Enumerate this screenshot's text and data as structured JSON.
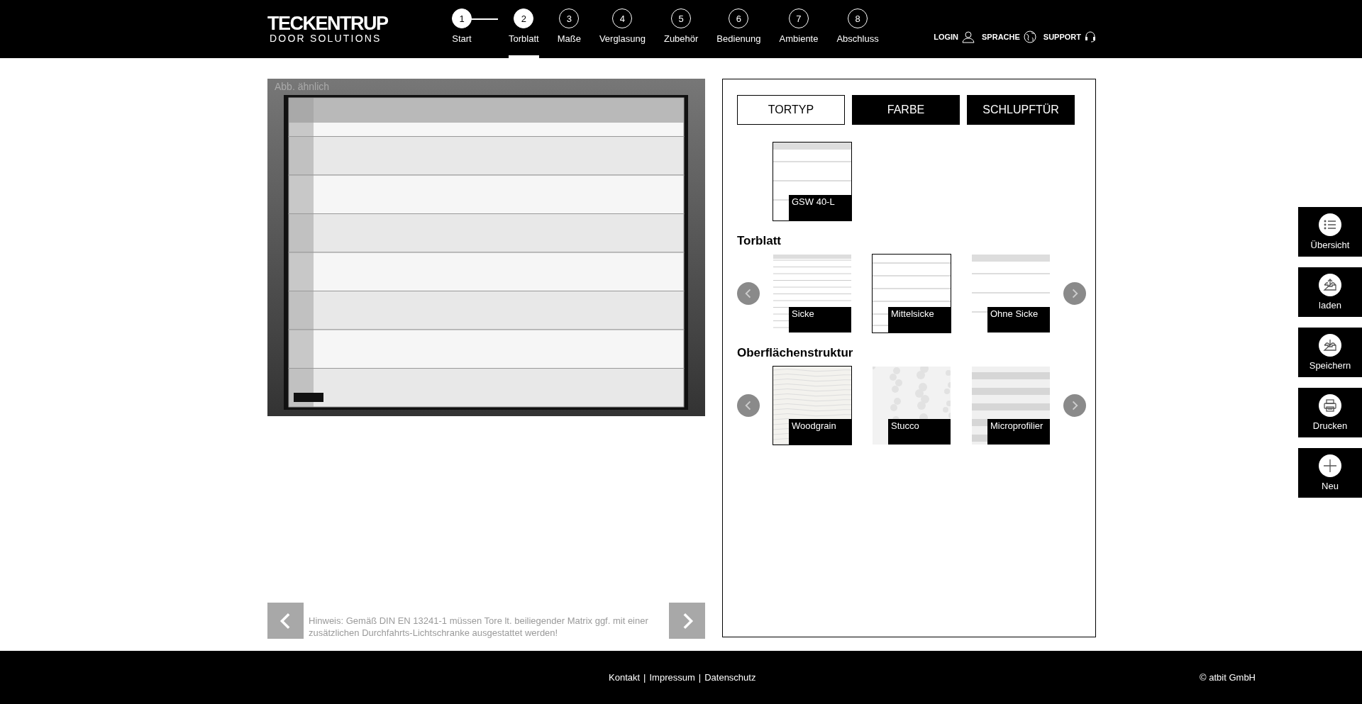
{
  "header": {
    "logo": {
      "brand": "TECKENTRUP",
      "tagline": "DOOR SOLUTIONS"
    },
    "steps": [
      {
        "number": "1",
        "label": "Start",
        "completed": true,
        "selected": false
      },
      {
        "number": "2",
        "label": "Torblatt",
        "completed": true,
        "selected": true
      },
      {
        "number": "3",
        "label": "Maße",
        "completed": false,
        "selected": false
      },
      {
        "number": "4",
        "label": "Verglasung",
        "completed": false,
        "selected": false
      },
      {
        "number": "5",
        "label": "Zubehör",
        "completed": false,
        "selected": false
      },
      {
        "number": "6",
        "label": "Bedienung",
        "completed": false,
        "selected": false
      },
      {
        "number": "7",
        "label": "Ambiente",
        "completed": false,
        "selected": false
      },
      {
        "number": "8",
        "label": "Abschluss",
        "completed": false,
        "selected": false
      }
    ],
    "links": [
      {
        "kind": "user",
        "label": "LOGIN"
      },
      {
        "kind": "globe",
        "label": "SPRACHE"
      },
      {
        "kind": "headset",
        "label": "SUPPORT"
      }
    ]
  },
  "preview": {
    "caption": "Abb. ähnlich",
    "hint": "Hinweis: Gemäß DIN EN 13241-1 müssen Tore lt. beiliegender Matrix ggf. mit einer zusätzlichen Durchfahrts-Lichtschranke ausgestattet werden!"
  },
  "options": {
    "tabs": [
      {
        "label": "TORTYP",
        "selected": true
      },
      {
        "label": "FARBE",
        "selected": false
      },
      {
        "label": "SCHLUPFTÜR",
        "selected": false
      }
    ],
    "door_types": [
      {
        "label": "GSW 40-L",
        "kind": "wide",
        "selected": true
      }
    ],
    "sections": [
      {
        "title": "Torblatt",
        "tiles": [
          {
            "label": "Sicke",
            "kind": "many",
            "selected": false
          },
          {
            "label": "Mittelsicke",
            "kind": "mid",
            "selected": true
          },
          {
            "label": "Ohne Sicke",
            "kind": "wide",
            "selected": false
          }
        ]
      },
      {
        "title": "Oberflächenstruktur",
        "tiles": [
          {
            "label": "Woodgrain",
            "kind": "woodgrain",
            "selected": true
          },
          {
            "label": "Stucco",
            "kind": "stucco",
            "selected": false
          },
          {
            "label": "Microprofilier",
            "kind": "stripes",
            "selected": false
          }
        ]
      }
    ]
  },
  "sidebar": [
    {
      "kind": "list",
      "label": "Übersicht"
    },
    {
      "kind": "upload",
      "label": "laden"
    },
    {
      "kind": "download",
      "label": "Speichern"
    },
    {
      "kind": "print",
      "label": "Drucken"
    },
    {
      "kind": "plus",
      "label": "Neu"
    }
  ],
  "footer": {
    "items": [
      {
        "kind": "link",
        "label": "Kontakt"
      },
      {
        "kind": "separator",
        "label": "|"
      },
      {
        "kind": "link",
        "label": "Impressum"
      },
      {
        "kind": "separator",
        "label": "|"
      },
      {
        "kind": "link",
        "label": "Datenschutz"
      }
    ],
    "copyright": "© atbit GmbH"
  }
}
